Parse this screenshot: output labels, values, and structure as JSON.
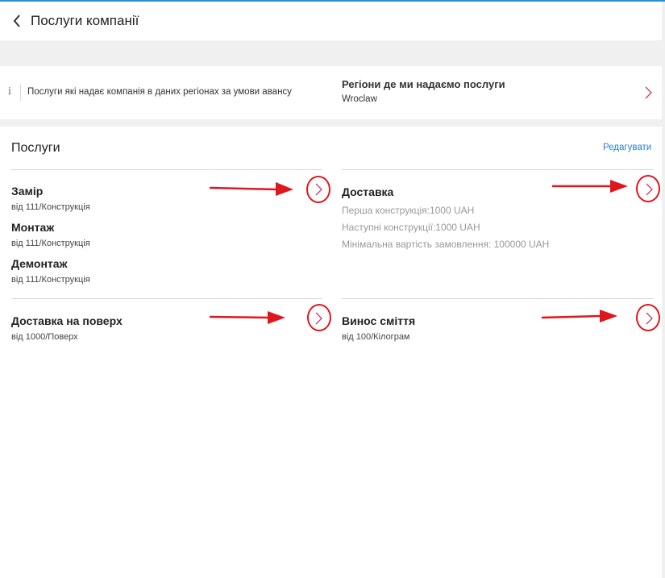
{
  "header": {
    "title": "Послуги компанії"
  },
  "info_card": {
    "info_text": "Послуги які надає компанія в даних регіонах за умови авансу",
    "regions_label": "Регіони де ми надаємо послуги",
    "regions_value": "Wroclaw"
  },
  "services": {
    "title": "Послуги",
    "edit_label": "Редагувати",
    "left_group": [
      {
        "name": "Замір",
        "price": "від 111/Конструкція"
      },
      {
        "name": "Монтаж",
        "price": "від 111/Конструкція"
      },
      {
        "name": "Демонтаж",
        "price": "від 111/Конструкція"
      }
    ],
    "delivery": {
      "name": "Доставка",
      "details": [
        "Перша конструкція:1000 UAH",
        "Наступні конструкції:1000 UAH",
        "Мінімальна вартість замовлення: 100000 UAH"
      ]
    },
    "floor_delivery": {
      "name": "Доставка на поверх",
      "price": "від 1000/Поверх"
    },
    "garbage": {
      "name": "Винос сміття",
      "price": "від 100/Кілограм"
    }
  },
  "colors": {
    "accent": "#2b7fc6",
    "chevron": "#c0415b",
    "annotation": "#e0161e"
  }
}
